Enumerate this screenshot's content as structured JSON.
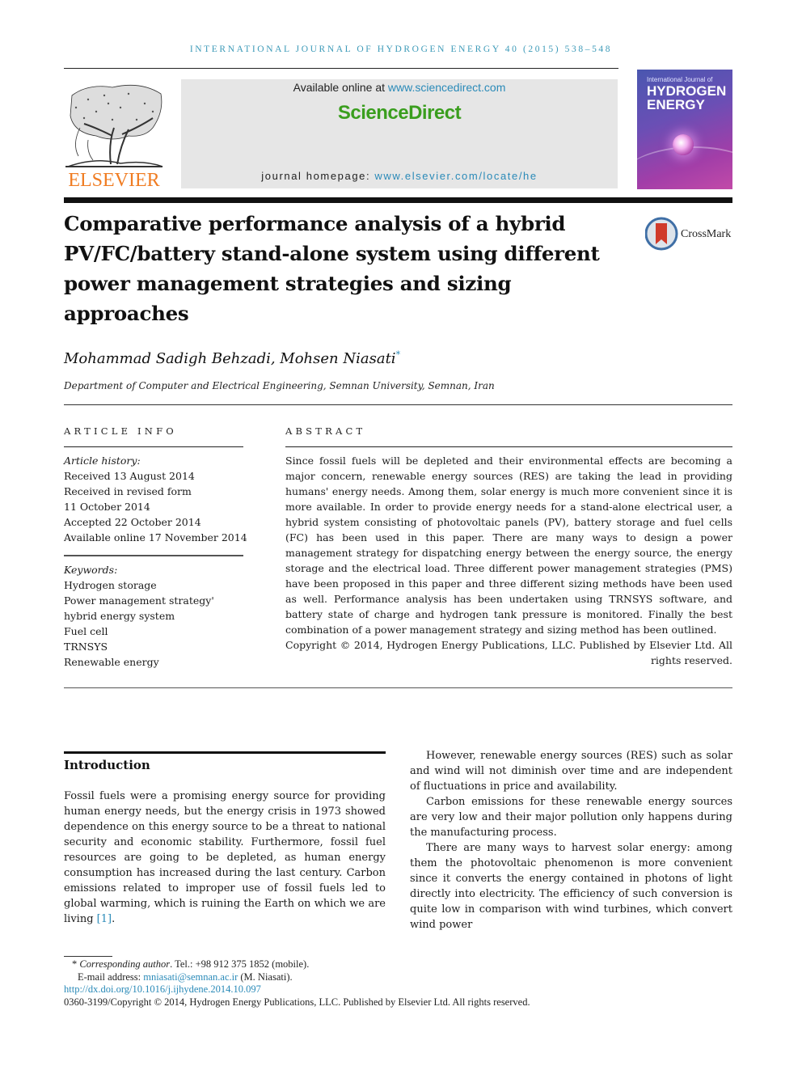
{
  "header": {
    "running_head": "INTERNATIONAL JOURNAL OF HYDROGEN ENERGY 40 (2015) 538–548",
    "publisher_logo_text": "ELSEVIER",
    "available_online_prefix": "Available online at ",
    "available_online_link": "www.sciencedirect.com",
    "brand": "ScienceDirect",
    "homepage_prefix": "journal homepage: ",
    "homepage_link": "www.elsevier.com/locate/he",
    "cover_small": "International Journal of",
    "cover_title_1": "HYDROGEN",
    "cover_title_2": "ENERGY",
    "crossmark": "CrossMark"
  },
  "article": {
    "title": "Comparative performance analysis of a hybrid PV/FC/battery stand-alone system using different power management strategies and sizing approaches",
    "authors": "Mohammad Sadigh Behzadi, Mohsen Niasati",
    "corresponding_mark": "*",
    "affiliation": "Department of Computer and Electrical Engineering, Semnan University, Semnan, Iran"
  },
  "article_info": {
    "heading": "ARTICLE INFO",
    "history_label": "Article history:",
    "history": [
      "Received 13 August 2014",
      "Received in revised form",
      "11 October 2014",
      "Accepted 22 October 2014",
      "Available online 17 November 2014"
    ],
    "keywords_label": "Keywords:",
    "keywords": [
      "Hydrogen storage",
      "Power management strategy' hybrid energy system",
      "Fuel cell",
      "TRNSYS",
      "Renewable energy"
    ]
  },
  "abstract": {
    "heading": "ABSTRACT",
    "text": "Since fossil fuels will be depleted and their environmental effects are becoming a major concern, renewable energy sources (RES) are taking the lead in providing humans' energy needs. Among them, solar energy is much more convenient since it is more available. In order to provide energy needs for a stand-alone electrical user, a hybrid system consisting of photovoltaic panels (PV), battery storage and fuel cells (FC) has been used in this paper. There are many ways to design a power management strategy for dispatching energy between the energy source, the energy storage and the electrical load. Three different power management strategies (PMS) have been proposed in this paper and three different sizing methods have been used as well. Performance analysis has been undertaken using TRNSYS software, and battery state of charge and hydrogen tank pressure is monitored. Finally the best combination of a power management strategy and sizing method has been outlined.",
    "copyright": "Copyright © 2014, Hydrogen Energy Publications, LLC. Published by Elsevier Ltd. All rights reserved."
  },
  "body": {
    "section_heading": "Introduction",
    "left_paragraph": "Fossil fuels were a promising energy source for providing human energy needs, but the energy crisis in 1973 showed dependence on this energy source to be a threat to national security and economic stability. Furthermore, fossil fuel resources are going to be depleted, as human energy consumption has increased during the last century. Carbon emissions related to improper use of fossil fuels led to global warming, which is ruining the Earth on which we are living ",
    "left_citation": "[1]",
    "right_paragraphs": [
      "However, renewable energy sources (RES) such as solar and wind will not diminish over time and are independent of fluctuations in price and availability.",
      "Carbon emissions for these renewable energy sources are very low and their major pollution only happens during the manufacturing process.",
      "There are many ways to harvest solar energy: among them the photovoltaic phenomenon is more convenient since it converts the energy contained in photons of light directly into electricity. The efficiency of such conversion is quite low in comparison with wind turbines, which convert wind power"
    ]
  },
  "footnotes": {
    "corresponding_mark": "*",
    "corresponding_label": "Corresponding author",
    "phone": ". Tel.: +98 912 375 1852 (mobile).",
    "email_label": "E-mail address: ",
    "email": "mniasati@semnan.ac.ir",
    "email_suffix": " (M. Niasati).",
    "doi": "http://dx.doi.org/10.1016/j.ijhydene.2014.10.097",
    "copyright": "0360-3199/Copyright © 2014, Hydrogen Energy Publications, LLC. Published by Elsevier Ltd. All rights reserved."
  },
  "colors": {
    "link": "#2a8ab8",
    "sciencedirect_green": "#3a9e1e",
    "elsevier_orange": "#f07c22",
    "running_head": "#3c9ab8"
  }
}
